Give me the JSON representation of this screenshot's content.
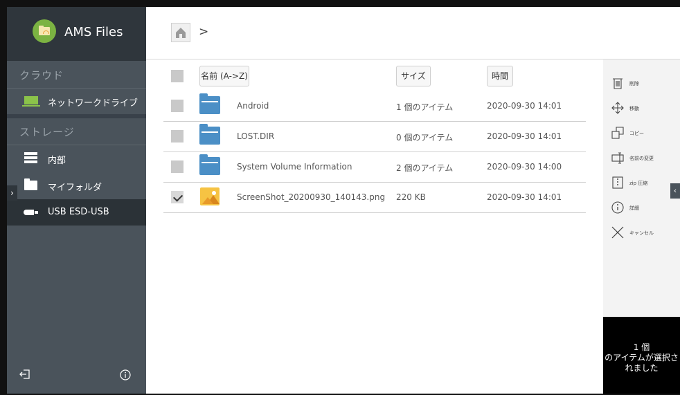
{
  "app": {
    "title": "AMS Files"
  },
  "sidebar": {
    "cloud_label": "クラウド",
    "network_drive": "ネットワークドライブ",
    "storage_label": "ストレージ",
    "internal": "内部",
    "my_folder": "マイフォルダ",
    "usb": "USB ESD-USB",
    "toggle": "›"
  },
  "breadcrumb": {
    "separator": ">"
  },
  "list": {
    "headers": {
      "name": "名前 (A->Z)",
      "size": "サイズ",
      "time": "時間"
    },
    "rows": [
      {
        "name": "Android",
        "size": "1 個のアイテム",
        "time": "2020-09-30 14:01",
        "type": "folder",
        "checked": false
      },
      {
        "name": "LOST.DIR",
        "size": "0 個のアイテム",
        "time": "2020-09-30 14:01",
        "type": "folder",
        "checked": false
      },
      {
        "name": "System Volume Information",
        "size": "2 個のアイテム",
        "time": "2020-09-30 14:00",
        "type": "folder",
        "checked": false
      },
      {
        "name": "ScreenShot_20200930_140143.png",
        "size": "220 KB",
        "time": "2020-09-30 14:01",
        "type": "image",
        "checked": true
      }
    ]
  },
  "actions": {
    "delete": "削除",
    "move": "移動",
    "copy": "コピー",
    "rename": "名前の変更",
    "zip": "zip 圧縮",
    "details": "詳細",
    "cancel": "キャンセル"
  },
  "panel_toggle": "‹",
  "status": {
    "line1": "1 個",
    "line2": "のアイテムが選択さ",
    "line3": "れました"
  },
  "colors": {
    "sidebar": "#4a535b",
    "sidebar_header": "#2f363c",
    "accent_green": "#8bc34a",
    "folder_blue": "#4b8fc6"
  }
}
